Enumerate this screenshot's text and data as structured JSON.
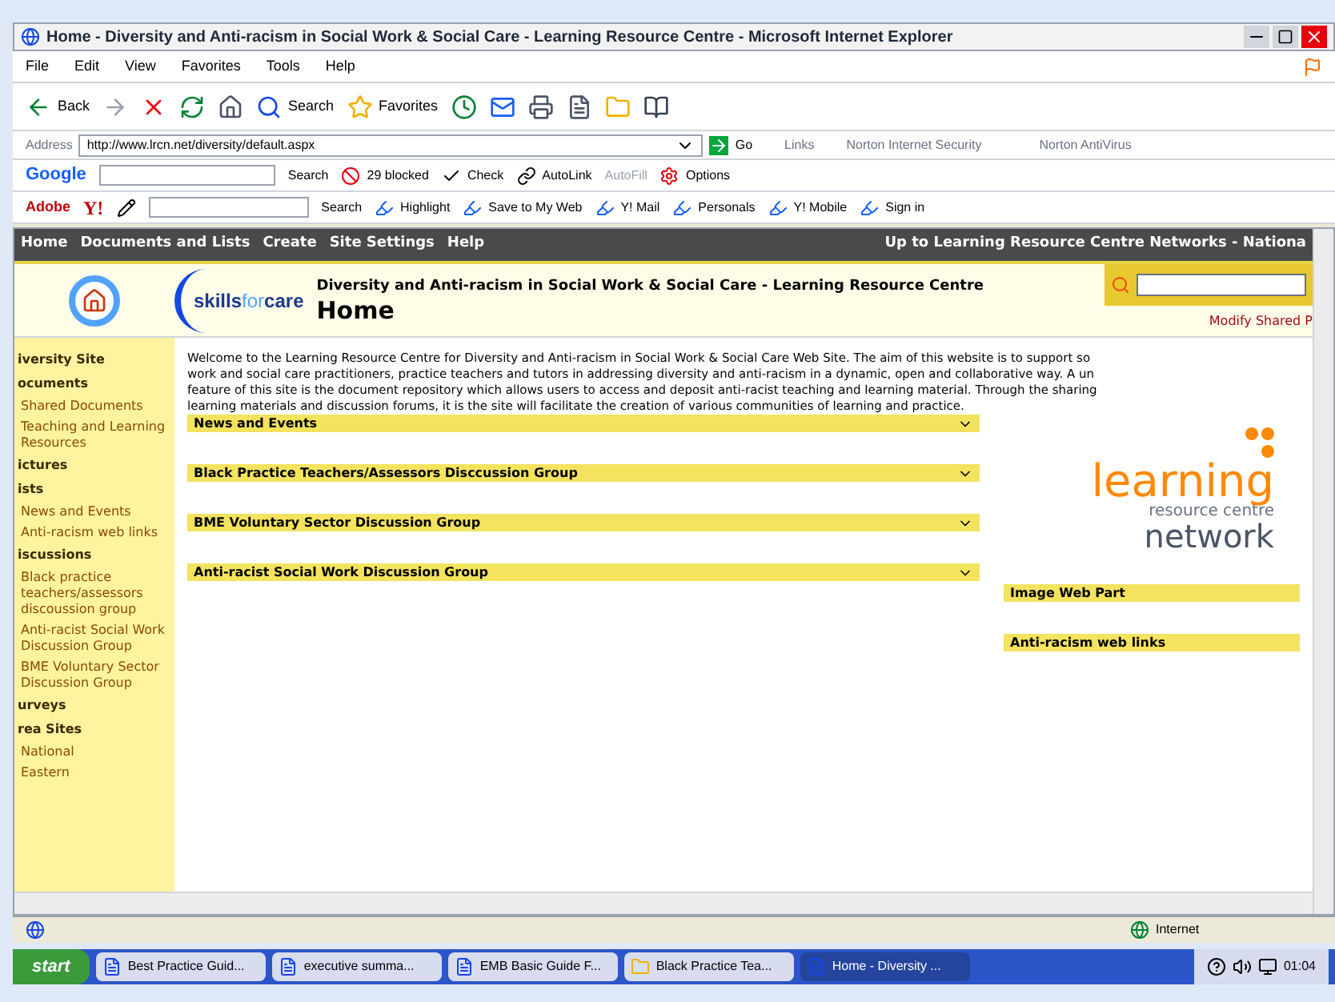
{
  "window": {
    "title": "Home - Diversity and Anti-racism in Social Work & Social Care - Learning Resource Centre - Microsoft Internet Explorer"
  },
  "menu": [
    "File",
    "Edit",
    "View",
    "Favorites",
    "Tools",
    "Help"
  ],
  "toolbar": [
    {
      "kind": "back",
      "label": "Back"
    },
    {
      "kind": "forward"
    },
    {
      "kind": "stop"
    },
    {
      "kind": "refresh"
    },
    {
      "kind": "home"
    },
    {
      "kind": "search",
      "label": "Search"
    },
    {
      "kind": "favorites",
      "label": "Favorites"
    },
    {
      "kind": "history"
    },
    {
      "kind": "mail"
    },
    {
      "kind": "print"
    },
    {
      "kind": "edit"
    },
    {
      "kind": "folder"
    },
    {
      "kind": "research"
    }
  ],
  "address_bar": {
    "label": "Address",
    "url": "http://www.lrcn.net/diversity/default.aspx",
    "go": "Go",
    "links": "Links",
    "norton_security": "Norton Internet Security",
    "norton_antivirus": "Norton AntiVirus"
  },
  "google_bar": {
    "logo": "Google",
    "search": "Search",
    "blocked": "29 blocked",
    "check": "Check",
    "autolink": "AutoLink",
    "autofill": {
      "label": "AutoFill",
      "disabled": true
    },
    "options": "Options"
  },
  "yahoo_bar": {
    "adobe": "Adobe",
    "logo": "Y!",
    "search": "Search",
    "items": [
      "Highlight",
      "Save to My Web",
      "Y! Mail",
      "Personals",
      "Y! Mobile",
      "Sign in"
    ]
  },
  "site_nav": {
    "items": [
      "Home",
      "Documents and Lists",
      "Create",
      "Site Settings",
      "Help"
    ],
    "up_link": "Up to Learning Resource Centre Networks - Nationa"
  },
  "header": {
    "logo": {
      "part_1": "skills",
      "part_2": "for",
      "part_3": "care"
    },
    "site_title": "Diversity and Anti-racism in Social Work & Social Care - Learning Resource Centre",
    "page_title": "Home",
    "modify_link": "Modify Shared P"
  },
  "sidebar": [
    {
      "kind": "heading",
      "label": "iversity Site"
    },
    {
      "kind": "heading",
      "label": "ocuments"
    },
    {
      "kind": "link",
      "label": "Shared Documents"
    },
    {
      "kind": "link",
      "label": "Teaching and Learning Resources"
    },
    {
      "kind": "heading",
      "label": "ictures"
    },
    {
      "kind": "heading",
      "label": "ists"
    },
    {
      "kind": "link",
      "label": "News and Events"
    },
    {
      "kind": "link",
      "label": "Anti-racism web links"
    },
    {
      "kind": "heading",
      "label": "iscussions"
    },
    {
      "kind": "link",
      "label": "Black practice teachers/assessors discoussion group"
    },
    {
      "kind": "link",
      "label": "Anti-racist Social Work Discussion Group"
    },
    {
      "kind": "link",
      "label": "BME Voluntary Sector Discussion Group"
    },
    {
      "kind": "heading",
      "label": "urveys"
    },
    {
      "kind": "heading",
      "label": "rea Sites"
    },
    {
      "kind": "link",
      "label": "National"
    },
    {
      "kind": "link",
      "label": "Eastern"
    }
  ],
  "intro_lines": [
    "Welcome to the Learning Resource Centre for Diversity and Anti-racism in Social Work & Social Care Web Site. The aim of this website is to support so",
    "work and social care practitioners, practice teachers and tutors in addressing diversity and anti-racism in a dynamic, open and collaborative way. A un",
    "feature of this site is the document repository which allows users to access and deposit anti-racist teaching and learning material. Through the sharing",
    "learning materials and discussion forums, it is the site will facilitate the creation of various communities of learning and practice."
  ],
  "web_parts": [
    "News and Events",
    "Black Practice Teachers/Assessors Disccussion Group",
    "BME Voluntary Sector Discussion Group",
    "Anti-racist Social Work Discussion Group"
  ],
  "right_logo": {
    "word": "learning",
    "line_2": "resource centre",
    "line_3": "network"
  },
  "right_parts": [
    "Image Web Part",
    "Anti-racism web links"
  ],
  "status_bar": {
    "zone": "Internet"
  },
  "taskbar": {
    "start": "start",
    "tasks": [
      {
        "label": "Best Practice Guid...",
        "kind": "doc",
        "selected": false
      },
      {
        "label": "executive summa...",
        "kind": "doc",
        "selected": false
      },
      {
        "label": "EMB Basic Guide F...",
        "kind": "doc",
        "selected": false
      },
      {
        "label": "Black Practice Tea...",
        "kind": "folder",
        "selected": false
      },
      {
        "label": "Home - Diversity ...",
        "kind": "page",
        "selected": true
      }
    ],
    "clock": "01:04"
  }
}
